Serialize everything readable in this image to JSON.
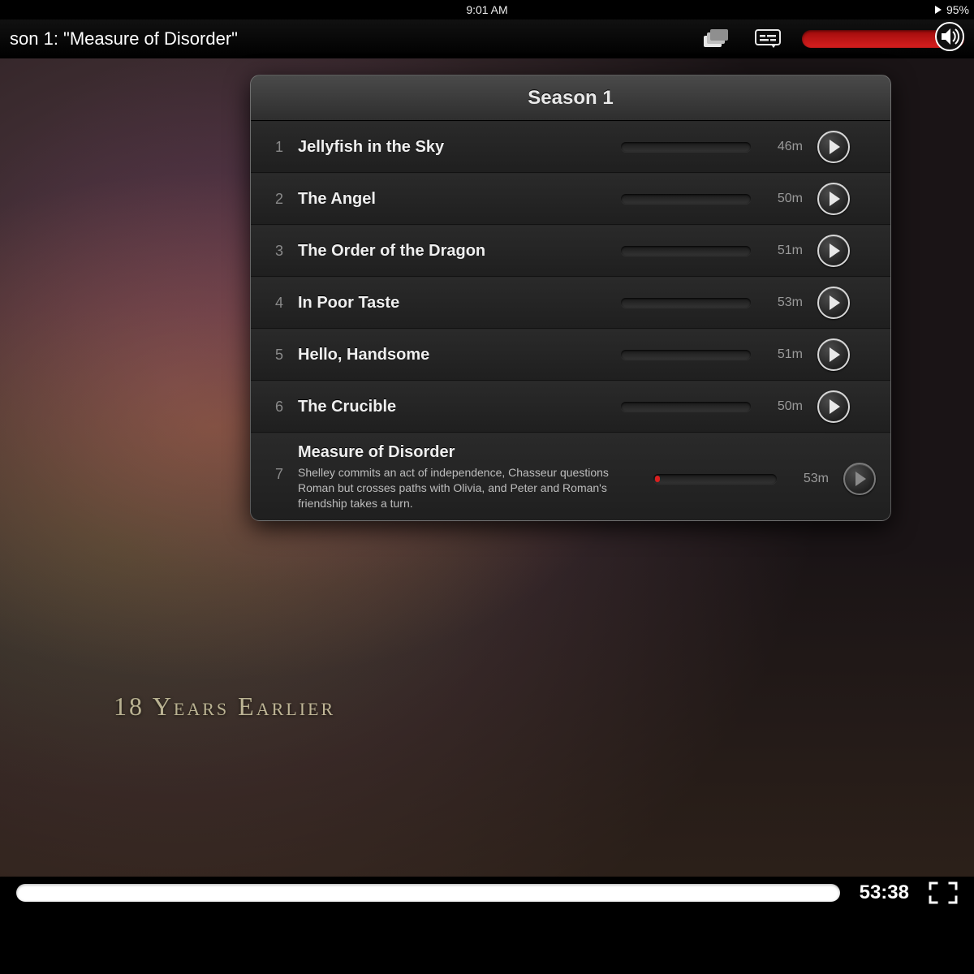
{
  "status": {
    "time": "9:01 AM",
    "battery": "95%"
  },
  "player": {
    "title": "son 1: \"Measure of Disorder\"",
    "time_remaining": "53:38"
  },
  "video_overlay_text": "18 Years Earlier",
  "popover": {
    "header": "Season 1",
    "episodes": [
      {
        "n": "1",
        "title": "Jellyfish in the Sky",
        "duration": "46m"
      },
      {
        "n": "2",
        "title": "The Angel",
        "duration": "50m"
      },
      {
        "n": "3",
        "title": "The Order of the Dragon",
        "duration": "51m"
      },
      {
        "n": "4",
        "title": "In Poor Taste",
        "duration": "53m"
      },
      {
        "n": "5",
        "title": "Hello, Handsome",
        "duration": "51m"
      },
      {
        "n": "6",
        "title": "The Crucible",
        "duration": "50m"
      },
      {
        "n": "7",
        "title": "Measure of Disorder",
        "duration": "53m",
        "description": "Shelley commits an act of independence, Chasseur questions Roman but crosses paths with Olivia, and Peter and Roman's friendship takes a turn."
      }
    ]
  }
}
